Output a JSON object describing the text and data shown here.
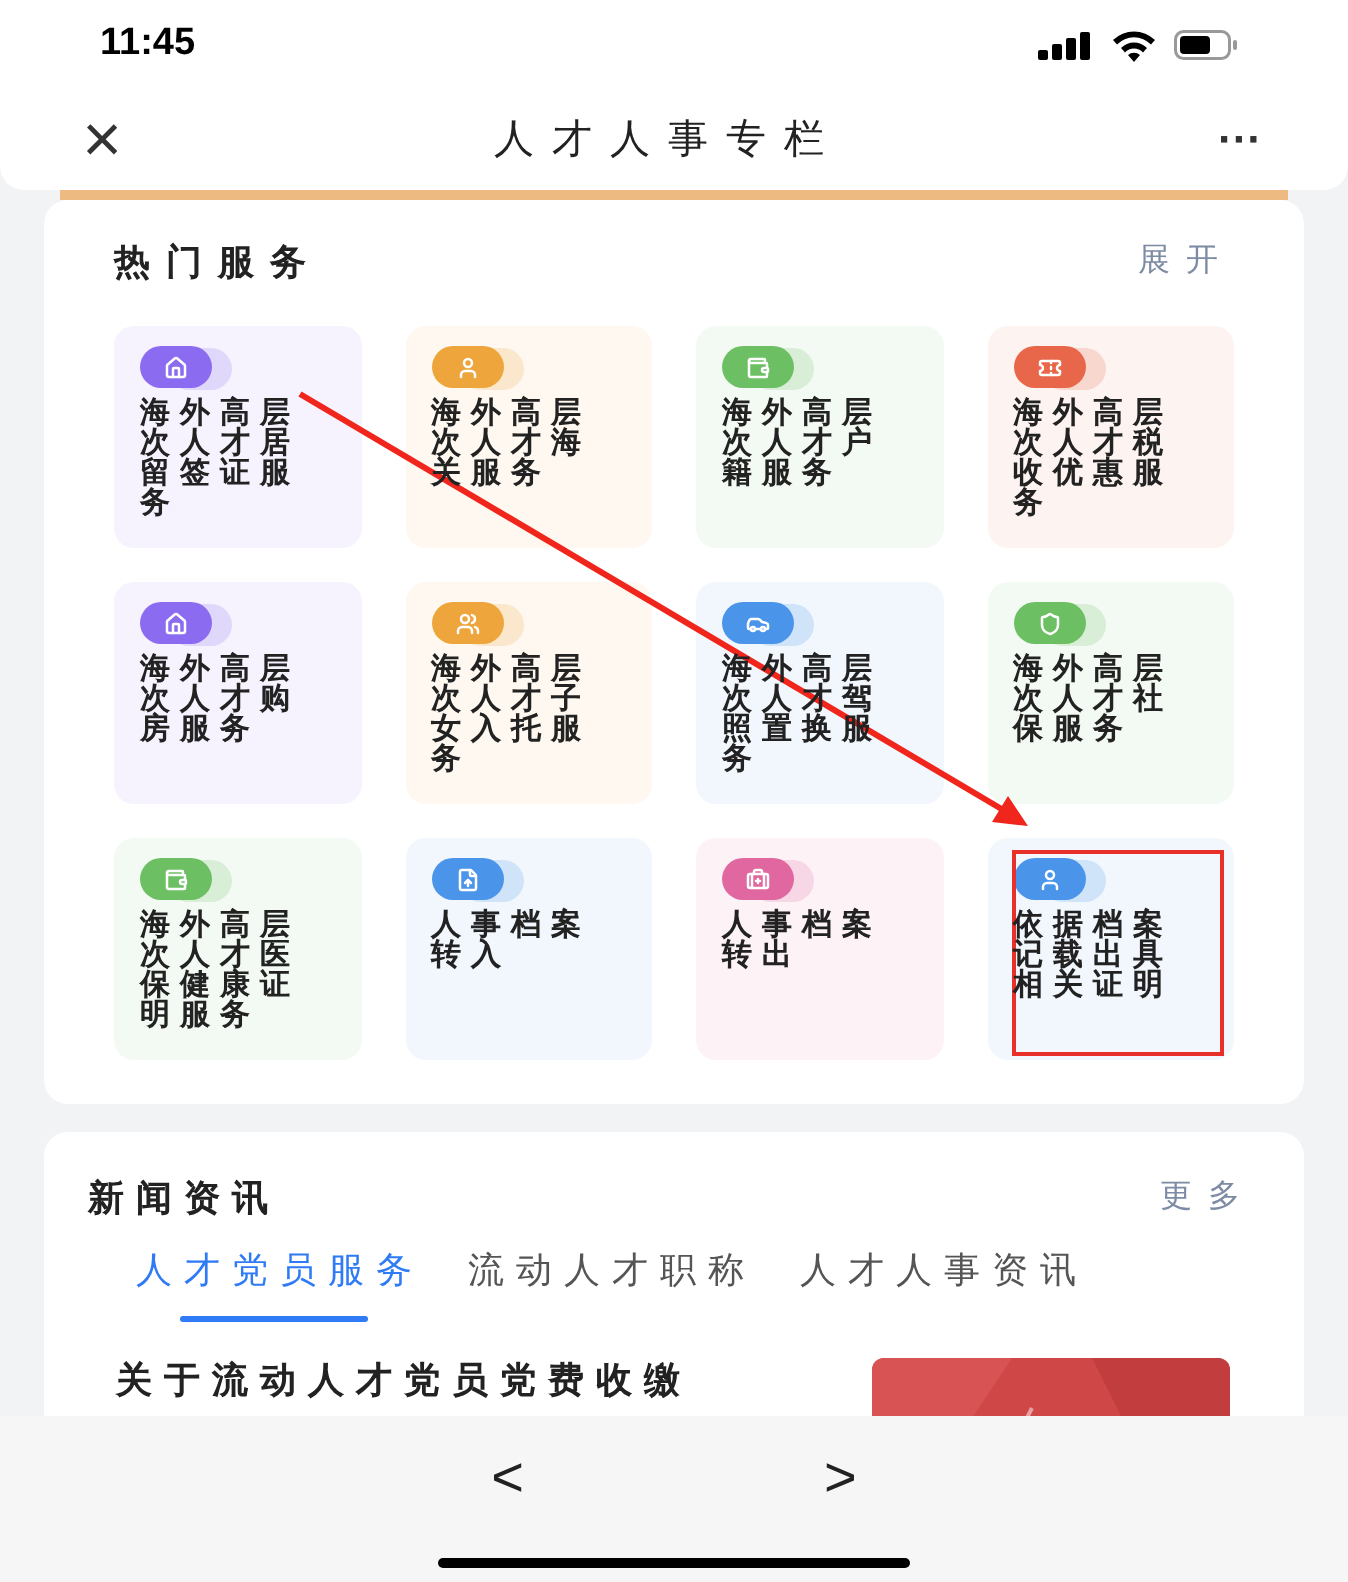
{
  "status_bar": {
    "time": "11:45"
  },
  "nav": {
    "close": "×",
    "title": "人才人事专栏",
    "more": "···"
  },
  "hot_services": {
    "title": "热门服务",
    "action": "展开",
    "items": [
      {
        "label": "海外高层次人才居留签证服务",
        "kind": "house",
        "color": "#8b6cf0",
        "highlighted": false
      },
      {
        "label": "海外高层次人才海关服务",
        "kind": "person",
        "color": "#eda53c",
        "highlighted": false
      },
      {
        "label": "海外高层次人才户籍服务",
        "kind": "bag",
        "color": "#6cc063",
        "highlighted": false
      },
      {
        "label": "海外高层次人才税收优惠服务",
        "kind": "ticket",
        "color": "#e8674a",
        "highlighted": false
      },
      {
        "label": "海外高层次人才购房服务",
        "kind": "house",
        "color": "#8b6cf0",
        "highlighted": false
      },
      {
        "label": "海外高层次人才子女入托服务",
        "kind": "people",
        "color": "#eda53c",
        "highlighted": false
      },
      {
        "label": "海外高层次人才驾照置换服务",
        "kind": "car",
        "color": "#4a94ea",
        "highlighted": false
      },
      {
        "label": "海外高层次人才社保服务",
        "kind": "shield",
        "color": "#6cc063",
        "highlighted": false
      },
      {
        "label": "海外高层次人才医保健康证明服务",
        "kind": "bag",
        "color": "#6cc063",
        "highlighted": false
      },
      {
        "label": "人事档案转入",
        "kind": "file",
        "color": "#4a94ea",
        "highlighted": false
      },
      {
        "label": "人事档案转出",
        "kind": "medical",
        "color": "#e0679f",
        "highlighted": false
      },
      {
        "label": "依据档案记载出具相关证明",
        "kind": "person",
        "color": "#4a94ea",
        "highlighted": true
      }
    ]
  },
  "annotation_arrow": true,
  "news": {
    "title": "新闻资讯",
    "action": "更多",
    "tabs": [
      {
        "label": "人才党员服务",
        "selected": true
      },
      {
        "label": "流动人才职称",
        "selected": false
      },
      {
        "label": "人才人事资讯",
        "selected": false
      }
    ],
    "headline": "关于流动人才党员党费收缴"
  },
  "bottom_bar": {
    "back": "<",
    "forward": ">"
  }
}
